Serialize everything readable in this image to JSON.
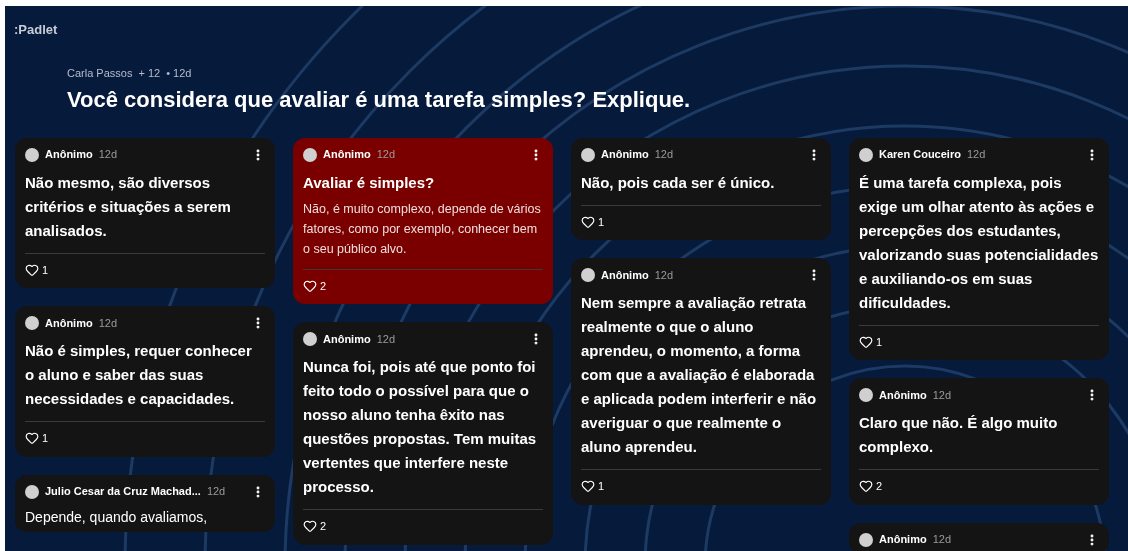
{
  "logo": ":Padlet",
  "header": {
    "author": "Carla Passos",
    "contributors": "+ 12",
    "age": "• 12d",
    "title": "Você considera que avaliar é uma tarefa simples? Explique."
  },
  "columns": [
    {
      "cards": [
        {
          "author": "Anônimo",
          "age": "12d",
          "title": "Não mesmo, são diversos critérios e situações a serem analisados.",
          "likes": "1"
        },
        {
          "author": "Anônimo",
          "age": "12d",
          "title": "Não é simples, requer conhecer o aluno e saber das suas necessidades e capacidades.",
          "likes": "1"
        },
        {
          "author": "Julio Cesar da Cruz Machad...",
          "age": "12d",
          "text": "Depende, quando avaliamos,"
        }
      ]
    },
    {
      "cards": [
        {
          "author": "Anônimo",
          "age": "12d",
          "title": "Avaliar é simples?",
          "body": "Não, é muito complexo, depende de vários fatores, como por exemplo, conhecer bem o seu público alvo.",
          "likes": "2",
          "color": "#7a0000"
        },
        {
          "author": "Anônimo",
          "age": "12d",
          "title": "Nunca foi, pois até que ponto foi feito todo o possível para que o nosso aluno tenha êxito nas questões propostas. Tem muitas vertentes que interfere neste processo.",
          "likes": "2"
        }
      ]
    },
    {
      "cards": [
        {
          "author": "Anônimo",
          "age": "12d",
          "title": "Não, pois cada ser é único.",
          "likes": "1"
        },
        {
          "author": "Anônimo",
          "age": "12d",
          "title": "Nem sempre a avaliação retrata realmente o que o aluno aprendeu, o momento, a forma com que a avaliação é elaborada e aplicada podem interferir e não averiguar o que realmente o aluno aprendeu.",
          "likes": "1"
        }
      ]
    },
    {
      "cards": [
        {
          "author": "Karen Couceiro",
          "age": "12d",
          "title": "É uma tarefa complexa, pois exige um olhar atento às ações e percepções dos estudantes, valorizando suas potencialidades e auxiliando-os em suas dificuldades.",
          "likes": "1"
        },
        {
          "author": "Anônimo",
          "age": "12d",
          "title": "Claro que não. É algo muito complexo.",
          "likes": "2"
        },
        {
          "author": "Anônimo",
          "age": "12d"
        }
      ]
    }
  ]
}
